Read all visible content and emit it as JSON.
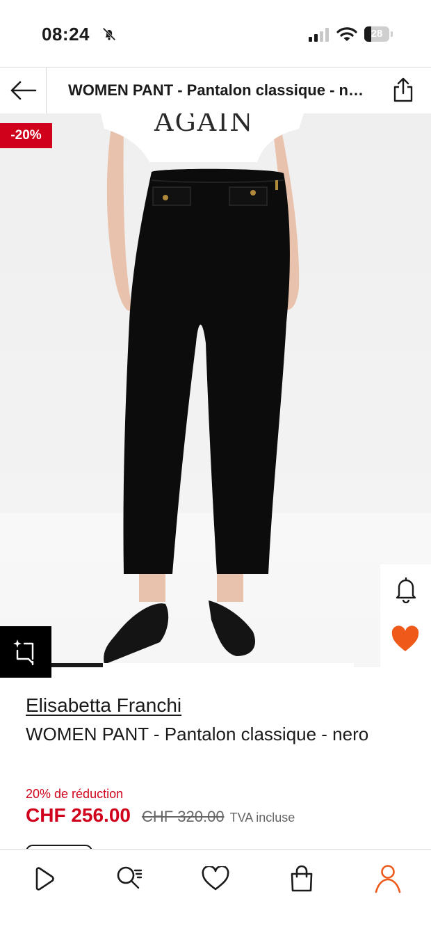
{
  "status_bar": {
    "time": "08:24",
    "battery_level": "28",
    "battery_fraction": 0.28
  },
  "header": {
    "title": "WOMEN PANT - Pantalon classique - nero"
  },
  "image": {
    "discount_badge": "-20%",
    "carousel_progress": 0.17,
    "shirt_text": "AGAIN"
  },
  "product": {
    "brand": "Elisabetta Franchi",
    "name": "WOMEN PANT - Pantalon classique - nero",
    "discount_text": "20% de réduction",
    "price": "CHF 256.00",
    "old_price": "CHF 320.00",
    "vat_note": "TVA incluse"
  },
  "tabs": [
    {
      "icon": "play-icon",
      "active": false
    },
    {
      "icon": "search-icon",
      "active": false
    },
    {
      "icon": "heart-icon",
      "active": false
    },
    {
      "icon": "bag-icon",
      "active": false
    },
    {
      "icon": "profile-icon",
      "active": true
    }
  ],
  "colors": {
    "accent": "#ef5a1a",
    "sale": "#d0021b",
    "text": "#1a1a1a"
  }
}
